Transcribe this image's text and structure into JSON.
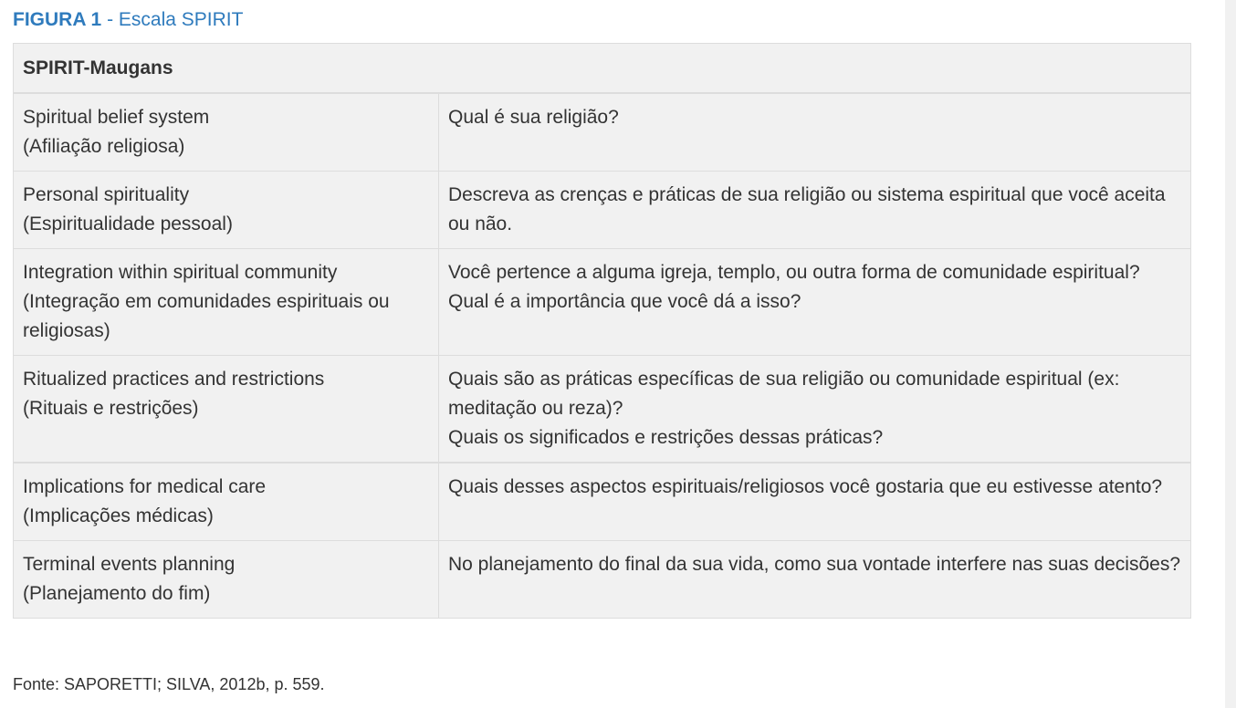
{
  "caption": {
    "label": "FIGURA 1",
    "separator": " - ",
    "title": "Escala SPIRIT"
  },
  "table": {
    "header": "SPIRIT-Maugans",
    "rows": [
      {
        "term": [
          "Spiritual belief system",
          "(Afiliação religiosa)"
        ],
        "question": [
          "Qual é sua religião?"
        ]
      },
      {
        "term": [
          "Personal spirituality",
          "(Espiritualidade pessoal)"
        ],
        "question": [
          "Descreva as crenças e práticas de sua religião ou sistema espiritual que você aceita ou não."
        ]
      },
      {
        "term": [
          "Integration within spiritual community",
          "(Integração em comunidades espirituais ou religiosas)"
        ],
        "question": [
          "Você pertence a alguma igreja, templo, ou outra forma de comunidade espiritual?",
          "Qual é a importância que você dá a isso?"
        ]
      },
      {
        "term": [
          "Ritualized practices and restrictions",
          "(Rituais e restrições)"
        ],
        "question": [
          "Quais são as práticas específicas de sua religião ou comunidade espiritual (ex: meditação ou reza)?",
          "Quais os significados e restrições dessas práticas?"
        ]
      },
      {
        "term": [
          "Implications for medical care",
          "(Implicações médicas)"
        ],
        "question": [
          "Quais desses aspectos espirituais/religiosos você gostaria que eu estivesse atento?"
        ]
      },
      {
        "term": [
          "Terminal events planning",
          "(Planejamento do fim)"
        ],
        "question": [
          "No planejamento do final da sua vida, como sua vontade interfere nas suas decisões?"
        ]
      }
    ]
  },
  "source": "Fonte: SAPORETTI; SILVA, 2012b, p. 559.",
  "colors": {
    "caption": "#2f7bbd",
    "text": "#333333",
    "table_bg": "#f1f1f1",
    "border": "#dddddd"
  }
}
